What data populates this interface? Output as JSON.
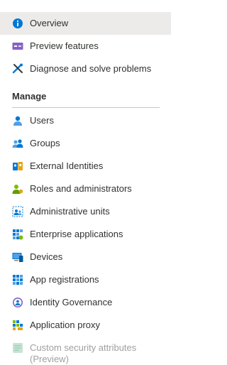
{
  "nav": {
    "top_items": [
      {
        "label": "Overview",
        "icon": "info-icon",
        "selected": true
      },
      {
        "label": "Preview features",
        "icon": "preview-features-icon"
      },
      {
        "label": "Diagnose and solve problems",
        "icon": "wrench-cross-icon"
      }
    ],
    "section_title": "Manage",
    "manage_items": [
      {
        "label": "Users",
        "icon": "user-icon"
      },
      {
        "label": "Groups",
        "icon": "group-icon"
      },
      {
        "label": "External Identities",
        "icon": "external-identities-icon"
      },
      {
        "label": "Roles and administrators",
        "icon": "roles-icon"
      },
      {
        "label": "Administrative units",
        "icon": "admin-units-icon"
      },
      {
        "label": "Enterprise applications",
        "icon": "enterprise-apps-icon"
      },
      {
        "label": "Devices",
        "icon": "device-icon"
      },
      {
        "label": "App registrations",
        "icon": "app-registrations-icon"
      },
      {
        "label": "Identity Governance",
        "icon": "identity-governance-icon"
      },
      {
        "label": "Application proxy",
        "icon": "application-proxy-icon"
      },
      {
        "label": "Custom security attributes (Preview)",
        "icon": "custom-security-attributes-icon",
        "disabled": true
      }
    ]
  },
  "colors": {
    "accent": "#0078d4",
    "selected_bg": "#edebe9",
    "disabled_text": "#a19f9d",
    "preview_purple": "#8661c5"
  }
}
